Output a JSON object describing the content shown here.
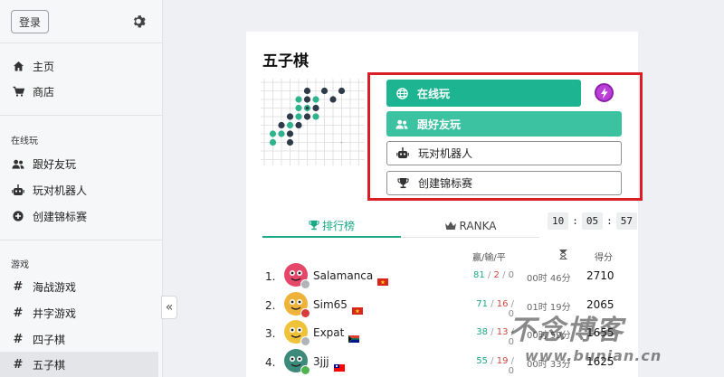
{
  "sidebar": {
    "login_label": "登录",
    "top_items": [
      {
        "label": "主页",
        "icon": "home-icon"
      },
      {
        "label": "商店",
        "icon": "cart-icon"
      }
    ],
    "online_section": "在线玩",
    "online_items": [
      {
        "label": "跟好友玩",
        "icon": "users-icon"
      },
      {
        "label": "玩对机器人",
        "icon": "robot-icon"
      },
      {
        "label": "创建锦标赛",
        "icon": "plus-circle-icon"
      }
    ],
    "games_section": "游戏",
    "game_items": [
      {
        "label": "海战游戏",
        "icon": "hash-icon"
      },
      {
        "label": "井字游戏",
        "icon": "hash-icon"
      },
      {
        "label": "四子棋",
        "icon": "hash-icon"
      },
      {
        "label": "五子棋",
        "icon": "hash-icon",
        "active": true
      }
    ],
    "collapse_glyph": "«"
  },
  "main": {
    "title": "五子棋",
    "buttons": {
      "online": "在线玩",
      "friend": "跟好友玩",
      "robot": "玩对机器人",
      "tournament": "创建锦标赛"
    },
    "tabs": {
      "leaderboard": "排行榜",
      "ranka": "RANKA"
    },
    "timer": {
      "h": "10",
      "m": "05",
      "s": "57"
    },
    "headers": {
      "record": "赢/输/平",
      "score": "得分"
    },
    "rows": [
      {
        "rank": "1.",
        "name": "Salamanca",
        "win": "81",
        "lose": "2",
        "draw": "0",
        "time": "00时 46分",
        "score": "2710",
        "avatar_color": "#e6466a",
        "status_color": "#b0b4b8",
        "flag": "vn"
      },
      {
        "rank": "2.",
        "name": "Sim65",
        "win": "71",
        "lose": "16",
        "draw": "0",
        "time": "01时 19分",
        "score": "2065",
        "avatar_color": "#f0b33a",
        "status_color": "#d93a3a",
        "flag": "vn"
      },
      {
        "rank": "3.",
        "name": "Expat",
        "win": "38",
        "lose": "13",
        "draw": "0",
        "time": "00时 59分",
        "score": "1655",
        "avatar_color": "#f0c23a",
        "status_color": "#b0b4b8",
        "flag": "za"
      },
      {
        "rank": "4.",
        "name": "3jjj",
        "win": "55",
        "lose": "19",
        "draw": "0",
        "time": "00时 33分",
        "score": "1625",
        "avatar_color": "#3c8b7a",
        "status_color": "#4fb34f",
        "flag": "tw"
      }
    ]
  },
  "watermark": {
    "main": "不念博客",
    "sub": "www.bunian.cn"
  },
  "colors": {
    "accent": "#1db591",
    "accent_light": "#3cc1a1",
    "highlight": "#d91e26",
    "bolt": "#b93fd8"
  }
}
